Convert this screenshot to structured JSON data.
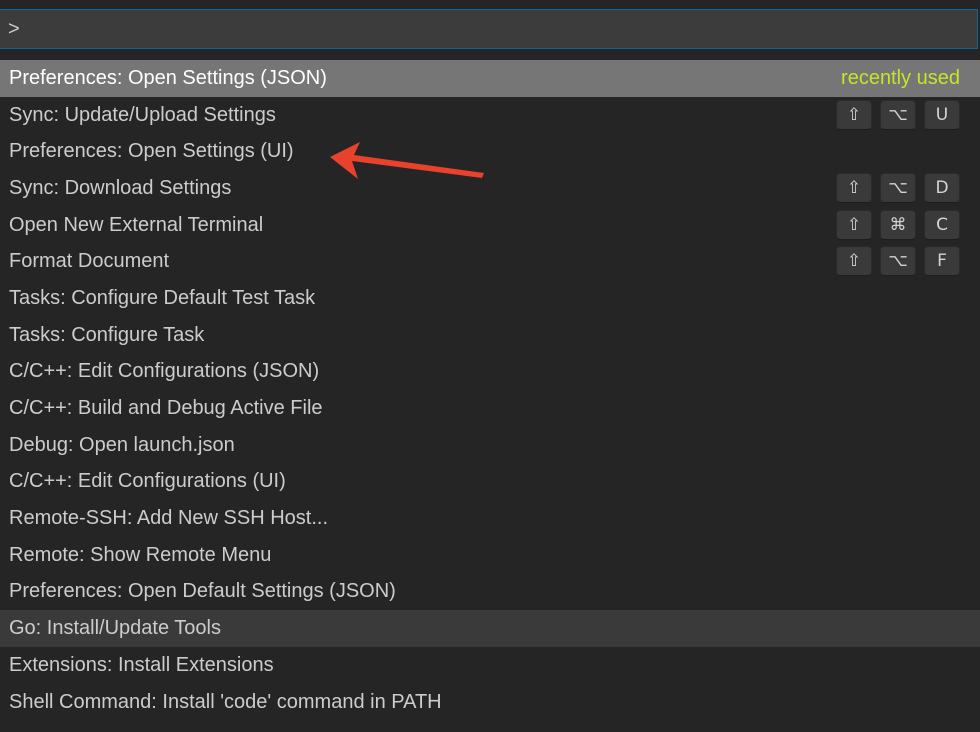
{
  "input": {
    "value": ">"
  },
  "items": [
    {
      "label": "Preferences: Open Settings (JSON)",
      "badge": "recently used",
      "keys": []
    },
    {
      "label": "Sync: Update/Upload Settings",
      "keys": [
        "⇧",
        "⌥",
        "U"
      ]
    },
    {
      "label": "Preferences: Open Settings (UI)",
      "keys": []
    },
    {
      "label": "Sync: Download Settings",
      "keys": [
        "⇧",
        "⌥",
        "D"
      ]
    },
    {
      "label": "Open New External Terminal",
      "keys": [
        "⇧",
        "⌘",
        "C"
      ]
    },
    {
      "label": "Format Document",
      "keys": [
        "⇧",
        "⌥",
        "F"
      ]
    },
    {
      "label": "Tasks: Configure Default Test Task",
      "keys": []
    },
    {
      "label": "Tasks: Configure Task",
      "keys": []
    },
    {
      "label": "C/C++: Edit Configurations (JSON)",
      "keys": []
    },
    {
      "label": "C/C++: Build and Debug Active File",
      "keys": []
    },
    {
      "label": "Debug: Open launch.json",
      "keys": []
    },
    {
      "label": "C/C++: Edit Configurations (UI)",
      "keys": []
    },
    {
      "label": "Remote-SSH: Add New SSH Host...",
      "keys": []
    },
    {
      "label": "Remote: Show Remote Menu",
      "keys": []
    },
    {
      "label": "Preferences: Open Default Settings (JSON)",
      "keys": []
    },
    {
      "label": "Go: Install/Update Tools",
      "keys": []
    },
    {
      "label": "Extensions: Install Extensions",
      "keys": []
    },
    {
      "label": "Shell Command: Install 'code' command in PATH",
      "keys": []
    }
  ],
  "colors": {
    "background": "#252526",
    "selected_row": "#767676",
    "hover_row": "#3a3a3a",
    "recently_used": "#c5e528",
    "annotation_arrow": "#e8412c"
  }
}
